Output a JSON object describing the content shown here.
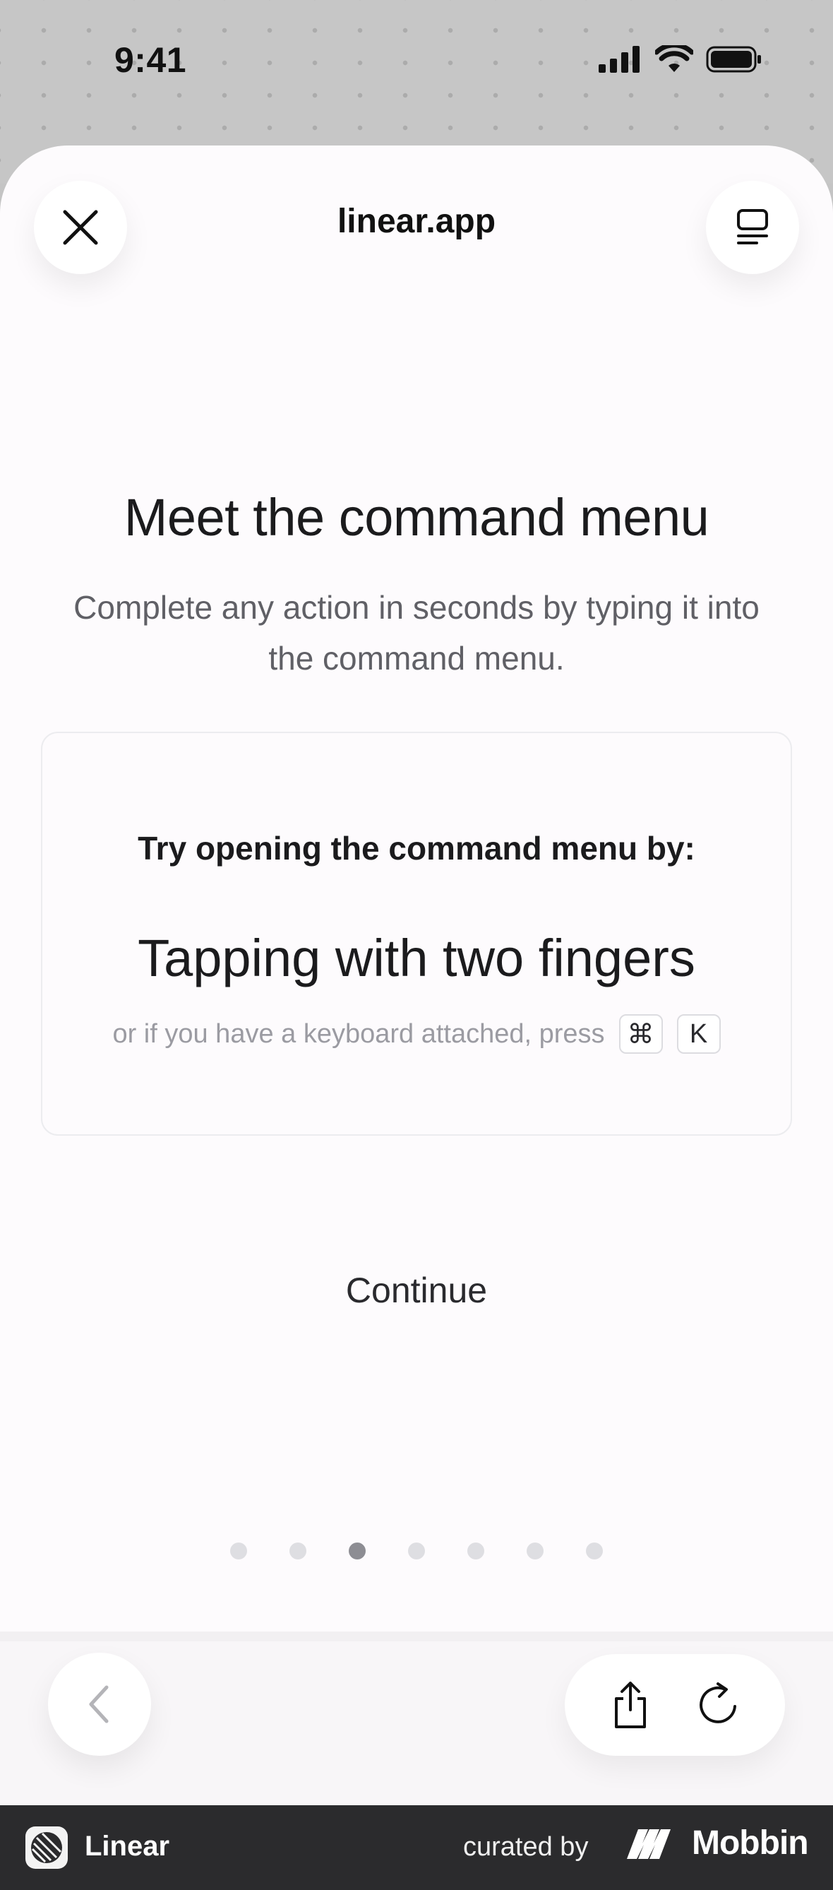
{
  "status_bar": {
    "time": "9:41",
    "signal_icon": "cellular-signal-icon",
    "wifi_icon": "wifi-icon",
    "battery_icon": "battery-icon"
  },
  "browser": {
    "site_title": "linear.app",
    "close_icon": "close-icon",
    "tabs_icon": "tab-overview-icon",
    "back_icon": "chevron-left-icon",
    "share_icon": "share-icon",
    "reload_icon": "reload-icon"
  },
  "onboarding": {
    "heading": "Meet the command menu",
    "subheading": "Complete any action in seconds by typing it into the command menu.",
    "card": {
      "label": "Try opening the command menu by:",
      "gesture": "Tapping with two fingers",
      "hint": "or if you have a keyboard attached, press",
      "keys": [
        "⌘",
        "K"
      ]
    },
    "continue_label": "Continue",
    "pagination": {
      "total": 7,
      "active_index": 2
    }
  },
  "footer": {
    "app_name": "Linear",
    "curated_by": "curated by",
    "brand": "Mobbin"
  },
  "colors": {
    "sheet_background": "#fdfbfd",
    "text_primary": "#1b1b1d",
    "text_secondary": "#606066",
    "footer_background": "#2b2b2d"
  }
}
